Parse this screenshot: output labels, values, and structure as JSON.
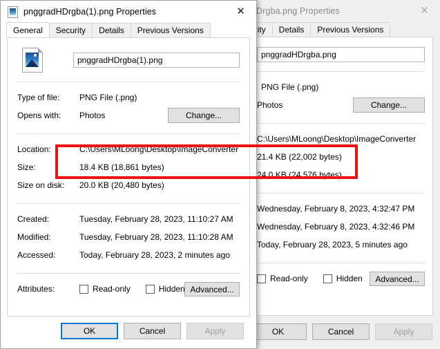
{
  "windows": [
    {
      "id": "back",
      "title": "Drgba.png Properties",
      "title_truncated_note": "partially occluded",
      "close_label": "✕",
      "tabs": [
        {
          "label": "urity",
          "active": false
        },
        {
          "label": "Details",
          "active": false
        },
        {
          "label": "Previous Versions",
          "active": false
        }
      ],
      "filename": "pnggradHDrgba.png",
      "fields": {
        "type_label": "Type of file:",
        "type_value": "PNG File (.png)",
        "opens_label": "Opens with:",
        "opens_value": "Photos",
        "change_button": "Change...",
        "location_label": "Location:",
        "location_value": "C:\\Users\\MLoong\\Desktop\\ImageConverter",
        "size_label": "Size:",
        "size_value": "21.4 KB (22,002 bytes)",
        "size_on_disk_label": "Size on disk:",
        "size_on_disk_value": "24.0 KB (24,576 bytes)",
        "created_label": "Created:",
        "created_value": "Wednesday, February 8, 2023, 4:32:47 PM",
        "modified_label": "Modified:",
        "modified_value": "Wednesday, February 8, 2023, 4:32:46 PM",
        "accessed_label": "Accessed:",
        "accessed_value": "Today, February 28, 2023, 5 minutes ago",
        "attributes_label": "Attributes:",
        "readonly_label": "Read-only",
        "hidden_label": "Hidden",
        "advanced_button": "Advanced..."
      },
      "footer": {
        "ok": "OK",
        "cancel": "Cancel",
        "apply": "Apply"
      }
    },
    {
      "id": "front",
      "title": "pnggradHDrgba(1).png Properties",
      "close_label": "✕",
      "tabs": [
        {
          "label": "General",
          "active": true
        },
        {
          "label": "Security",
          "active": false
        },
        {
          "label": "Details",
          "active": false
        },
        {
          "label": "Previous Versions",
          "active": false
        }
      ],
      "filename": "pnggradHDrgba(1).png",
      "fields": {
        "type_label": "Type of file:",
        "type_value": "PNG File (.png)",
        "opens_label": "Opens with:",
        "opens_value": "Photos",
        "change_button": "Change...",
        "location_label": "Location:",
        "location_value": "C:\\Users\\MLoong\\Desktop\\ImageConverter",
        "size_label": "Size:",
        "size_value": "18.4 KB (18,861 bytes)",
        "size_on_disk_label": "Size on disk:",
        "size_on_disk_value": "20.0 KB (20,480 bytes)",
        "created_label": "Created:",
        "created_value": "Tuesday, February 28, 2023, 11:10:27 AM",
        "modified_label": "Modified:",
        "modified_value": "Tuesday, February 28, 2023, 11:10:28 AM",
        "accessed_label": "Accessed:",
        "accessed_value": "Today, February 28, 2023, 2 minutes ago",
        "attributes_label": "Attributes:",
        "readonly_label": "Read-only",
        "hidden_label": "Hidden",
        "advanced_button": "Advanced..."
      },
      "footer": {
        "ok": "OK",
        "cancel": "Cancel",
        "apply": "Apply"
      }
    }
  ],
  "annotation": {
    "shape": "rectangle",
    "color": "#ee1111",
    "highlights": "size and size-on-disk rows of both dialogs"
  },
  "colors": {
    "accent": "#0078d7",
    "annotation": "#ee1111",
    "window_bg": "#f0f0f0",
    "page_bg": "#ffffff",
    "disabled_text": "#a0a0a0"
  }
}
